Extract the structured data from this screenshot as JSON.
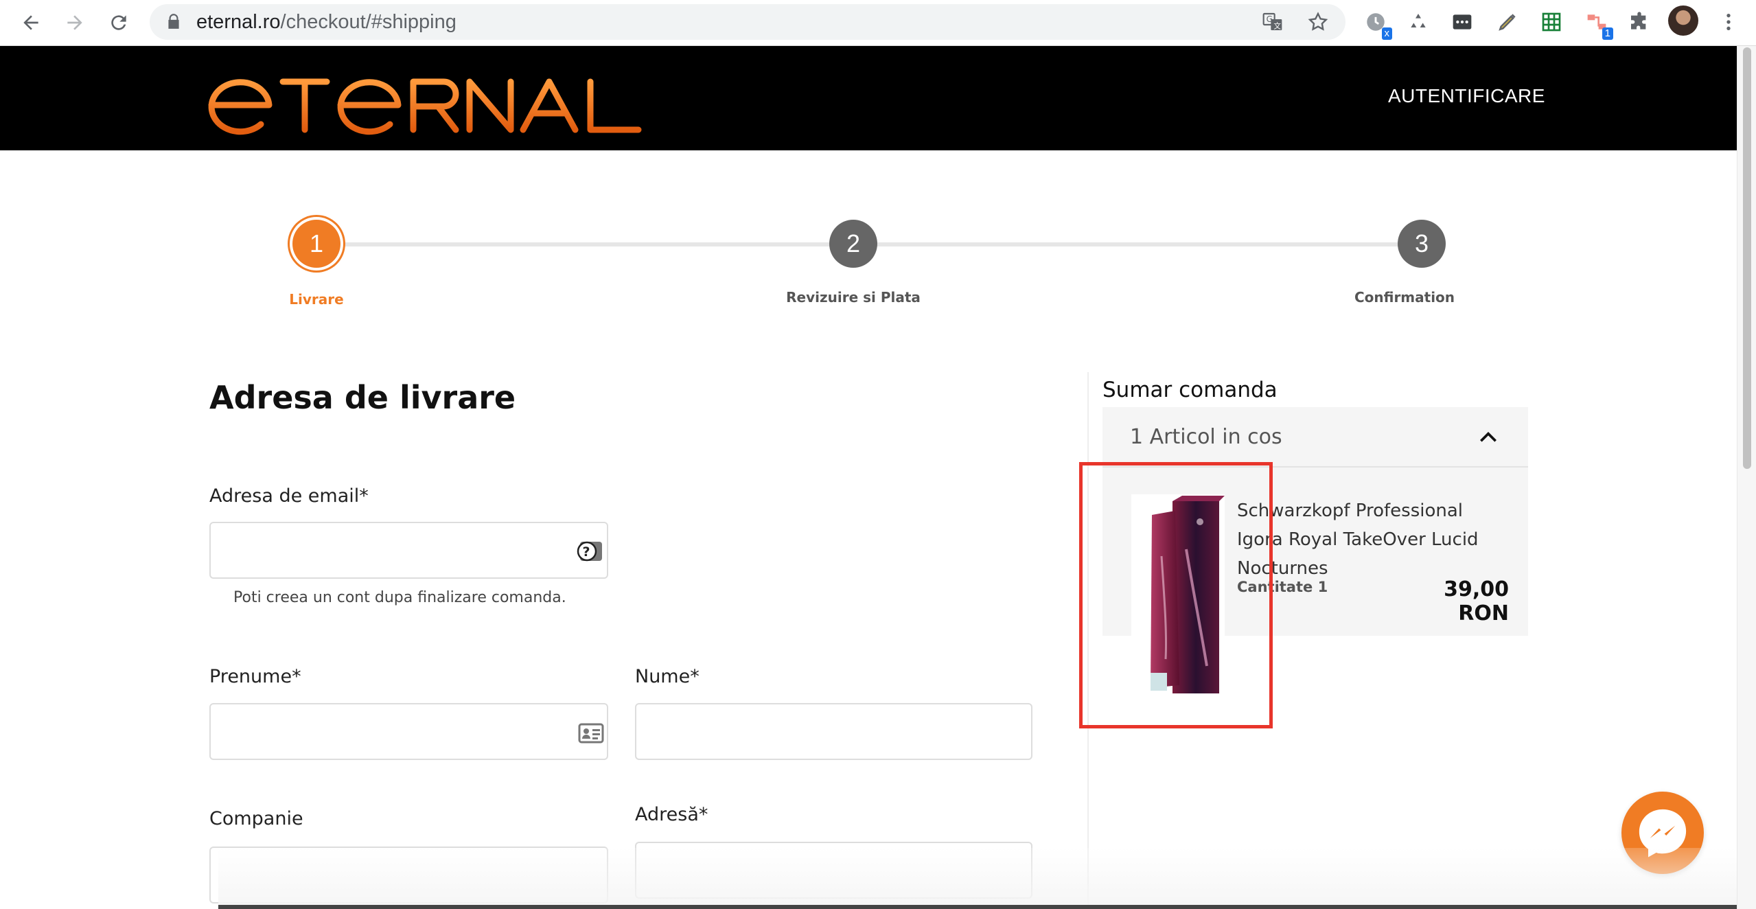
{
  "browser": {
    "url_host": "eternal.ro",
    "url_path": "/checkout/#shipping",
    "extension_badges": [
      "x",
      "1"
    ],
    "icons": [
      "back-icon",
      "forward-icon",
      "reload-icon",
      "lock-icon",
      "translate-icon",
      "bookmark-star-icon",
      "extensions-puzzle-icon",
      "kebab-menu-icon"
    ]
  },
  "header": {
    "logo_text": "eTeRNAL",
    "login_label": "AUTENTIFICARE"
  },
  "stepper": {
    "steps": [
      {
        "number": "1",
        "label": "Livrare",
        "state": "active"
      },
      {
        "number": "2",
        "label": "Revizuire si Plata",
        "state": "inactive"
      },
      {
        "number": "3",
        "label": "Confirmation",
        "state": "inactive"
      }
    ]
  },
  "form": {
    "title": "Adresa de livrare",
    "email_label": "Adresa de email*",
    "email_value": "",
    "email_hint": "Poti creea un cont dupa finalizare comanda.",
    "firstname_label": "Prenume*",
    "firstname_value": "",
    "lastname_label": "Nume*",
    "lastname_value": "",
    "company_label": "Companie",
    "company_value": "",
    "address_label": "Adresă*",
    "address_value": ""
  },
  "summary": {
    "title": "Sumar comanda",
    "cart_count": "1 Articol in cos",
    "items": [
      {
        "name": "Schwarzkopf Professional Igora Royal TakeOver Lucid Nocturnes",
        "quantity_label": "Cantitate 1",
        "price": "39,00 RON"
      }
    ]
  },
  "colors": {
    "accent": "#f07c24",
    "header_bg": "#000000",
    "step_inactive": "#666666",
    "highlight": "#e8352b"
  }
}
